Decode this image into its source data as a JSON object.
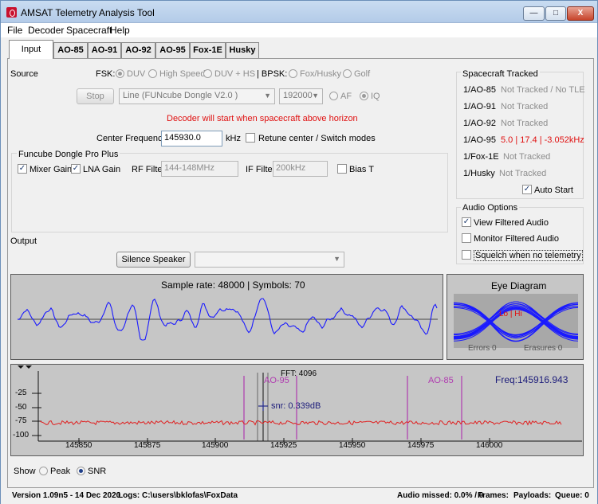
{
  "window": {
    "title": "AMSAT Telemetry Analysis Tool",
    "min": "—",
    "max": "□",
    "close": "X"
  },
  "menu": [
    "File",
    "Decoder",
    "Spacecraft",
    "Help"
  ],
  "tabs": [
    "Input",
    "AO-85",
    "AO-91",
    "AO-92",
    "AO-95",
    "Fox-1E",
    "Husky"
  ],
  "source": {
    "label": "Source",
    "fsk_label": "FSK:",
    "fsk_options": [
      "DUV",
      "High Speed",
      "DUV + HS"
    ],
    "bpsk_label": "| BPSK:",
    "bpsk_options": [
      "Fox/Husky",
      "Golf"
    ],
    "stop_button": "Stop",
    "source_combo": "Line (FUNcube Dongle V2.0 )",
    "rate_combo": "192000",
    "af_label": "AF",
    "iq_label": "IQ",
    "decoder_msg": "Decoder will start when spacecraft above horizon",
    "center_freq_label": "Center Frequency",
    "center_freq_value": "145930.0",
    "khz_label": "kHz",
    "retune_label": "Retune center / Switch modes"
  },
  "funcube": {
    "title": "Funcube Dongle Pro Plus",
    "mixer_gain": "Mixer Gain",
    "lna_gain": "LNA Gain",
    "rf_filter_label": "RF Filter",
    "rf_filter_value": "144-148MHz",
    "if_filter_label": "IF Filter",
    "if_filter_value": "200kHz",
    "bias_t": "Bias T"
  },
  "output": {
    "label": "Output",
    "silence_button": "Silence Speaker",
    "combo": ""
  },
  "tracked": {
    "title": "Spacecraft Tracked",
    "items": [
      {
        "name": "1/AO-85",
        "status": "Not Tracked / No TLE",
        "active": false
      },
      {
        "name": "1/AO-91",
        "status": "Not Tracked",
        "active": false
      },
      {
        "name": "1/AO-92",
        "status": "Not Tracked",
        "active": false
      },
      {
        "name": "1/AO-95",
        "status": "5.0 | 17.4 | -3.052kHz",
        "active": true
      },
      {
        "name": "1/Fox-1E",
        "status": "Not Tracked",
        "active": false
      },
      {
        "name": "1/Husky",
        "status": "Not Tracked",
        "active": false
      }
    ],
    "auto_start": "Auto Start"
  },
  "audio": {
    "title": "Audio Options",
    "view_filtered": "View Filtered Audio",
    "monitor_filtered": "Monitor Filtered Audio",
    "squelch": "Squelch when no telemetry"
  },
  "waveform": {
    "title": "Sample rate: 48000 | Symbols: 70"
  },
  "eye": {
    "title": "Eye Diagram",
    "center_label": "Lo | Hi",
    "errors_label": "Errors 0",
    "erasures_label": "Erasures 0"
  },
  "fft": {
    "title": "FFT: 4096",
    "freq_label": "Freq:145916.943",
    "snr_label": "snr: 0.339dB",
    "sat_labels": [
      "AO-95",
      "AO-85"
    ],
    "y_ticks": [
      "-25",
      "-50",
      "-75",
      "-100"
    ],
    "x_ticks": [
      "145850",
      "145875",
      "145900",
      "145925",
      "145950",
      "145975",
      "146000"
    ]
  },
  "show": {
    "label": "Show",
    "peak": "Peak",
    "snr": "SNR"
  },
  "status": {
    "version": "Version 1.09n5 - 14 Dec 2020",
    "logs": "Logs: C:\\users\\bklofas\\FoxData",
    "audio_missed": "Audio missed: 0.0% / 0",
    "frames": "Frames:",
    "payloads": "Payloads:",
    "queue": "Queue: 0"
  },
  "colors": {
    "accent_red": "#e01010",
    "trace_blue": "#1a1aff",
    "fft_red": "#e02020",
    "marker_purple": "#b03ab0"
  }
}
